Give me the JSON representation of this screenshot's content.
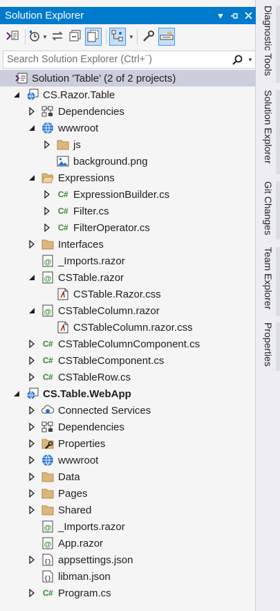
{
  "panel": {
    "title": "Solution Explorer",
    "title_buttons": [
      "dropdown-icon",
      "pin-icon",
      "close-icon"
    ]
  },
  "toolbar": {
    "items": [
      "switch-views-icon",
      "history-icon",
      "sync-icon",
      "collapse-all-icon",
      "show-all-files-icon",
      "git-filter-icon",
      "properties-icon",
      "preview-selected-icon"
    ]
  },
  "search": {
    "placeholder": "Search Solution Explorer (Ctrl+¨)"
  },
  "tree": [
    {
      "label": "Solution 'Table' (2 of 2 projects)",
      "icon": "solution",
      "level": 0,
      "expander": "none",
      "selected": true
    },
    {
      "label": "CS.Razor.Table",
      "icon": "project",
      "level": 1,
      "expander": "expanded"
    },
    {
      "label": "Dependencies",
      "icon": "dependencies",
      "level": 2,
      "expander": "collapsed"
    },
    {
      "label": "wwwroot",
      "icon": "globe",
      "level": 2,
      "expander": "expanded"
    },
    {
      "label": "js",
      "icon": "folder",
      "level": 3,
      "expander": "collapsed"
    },
    {
      "label": "background.png",
      "icon": "image",
      "level": 3,
      "expander": "none"
    },
    {
      "label": "Expressions",
      "icon": "folder-open",
      "level": 2,
      "expander": "expanded"
    },
    {
      "label": "ExpressionBuilder.cs",
      "icon": "csharp",
      "level": 3,
      "expander": "collapsed"
    },
    {
      "label": "Filter.cs",
      "icon": "csharp",
      "level": 3,
      "expander": "collapsed"
    },
    {
      "label": "FilterOperator.cs",
      "icon": "csharp",
      "level": 3,
      "expander": "collapsed"
    },
    {
      "label": "Interfaces",
      "icon": "folder",
      "level": 2,
      "expander": "collapsed"
    },
    {
      "label": "_Imports.razor",
      "icon": "razor",
      "level": 2,
      "expander": "none"
    },
    {
      "label": "CSTable.razor",
      "icon": "razor",
      "level": 2,
      "expander": "expanded"
    },
    {
      "label": "CSTable.Razor.css",
      "icon": "css",
      "level": 3,
      "expander": "none"
    },
    {
      "label": "CSTableColumn.razor",
      "icon": "razor",
      "level": 2,
      "expander": "expanded"
    },
    {
      "label": "CSTableColumn.razor.css",
      "icon": "css",
      "level": 3,
      "expander": "none"
    },
    {
      "label": "CSTableColumnComponent.cs",
      "icon": "csharp",
      "level": 2,
      "expander": "collapsed"
    },
    {
      "label": "CSTableComponent.cs",
      "icon": "csharp",
      "level": 2,
      "expander": "collapsed"
    },
    {
      "label": "CSTableRow.cs",
      "icon": "csharp",
      "level": 2,
      "expander": "collapsed"
    },
    {
      "label": "CS.Table.WebApp",
      "icon": "project",
      "level": 1,
      "expander": "expanded",
      "bold": true
    },
    {
      "label": "Connected Services",
      "icon": "connected",
      "level": 2,
      "expander": "collapsed"
    },
    {
      "label": "Dependencies",
      "icon": "dependencies",
      "level": 2,
      "expander": "collapsed"
    },
    {
      "label": "Properties",
      "icon": "properties",
      "level": 2,
      "expander": "collapsed"
    },
    {
      "label": "wwwroot",
      "icon": "globe",
      "level": 2,
      "expander": "collapsed"
    },
    {
      "label": "Data",
      "icon": "folder",
      "level": 2,
      "expander": "collapsed"
    },
    {
      "label": "Pages",
      "icon": "folder",
      "level": 2,
      "expander": "collapsed"
    },
    {
      "label": "Shared",
      "icon": "folder",
      "level": 2,
      "expander": "collapsed"
    },
    {
      "label": "_Imports.razor",
      "icon": "razor",
      "level": 2,
      "expander": "none"
    },
    {
      "label": "App.razor",
      "icon": "razor",
      "level": 2,
      "expander": "none"
    },
    {
      "label": "appsettings.json",
      "icon": "json",
      "level": 2,
      "expander": "collapsed"
    },
    {
      "label": "libman.json",
      "icon": "json",
      "level": 2,
      "expander": "none"
    },
    {
      "label": "Program.cs",
      "icon": "csharp",
      "level": 2,
      "expander": "collapsed"
    }
  ],
  "side_tabs": [
    "Diagnostic Tools",
    "Solution Explorer",
    "Git Changes",
    "Team Explorer",
    "Properties"
  ],
  "colors": {
    "accent": "#007acc",
    "folder": "#dcb67a",
    "csharp": "#388a34",
    "globe": "#1e6fd9"
  }
}
